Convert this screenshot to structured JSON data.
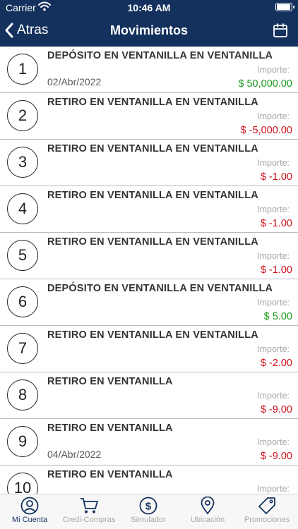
{
  "status": {
    "carrier": "Carrier",
    "time": "10:46 AM"
  },
  "nav": {
    "back_label": "Atras",
    "title": "Movimientos"
  },
  "movements": [
    {
      "index": "1",
      "description": "DEPÓSITO EN VENTANILLA EN VENTANILLA",
      "date": "02/Abr/2022",
      "amount_label": "Importe:",
      "amount": "$ 50,000.00",
      "sign": "pos"
    },
    {
      "index": "2",
      "description": "RETIRO EN VENTANILLA EN VENTANILLA",
      "date": "",
      "amount_label": "Importe:",
      "amount": "$ -5,000.00",
      "sign": "neg"
    },
    {
      "index": "3",
      "description": "RETIRO EN VENTANILLA EN VENTANILLA",
      "date": "",
      "amount_label": "Importe:",
      "amount": "$ -1.00",
      "sign": "neg"
    },
    {
      "index": "4",
      "description": "RETIRO EN VENTANILLA EN VENTANILLA",
      "date": "",
      "amount_label": "Importe:",
      "amount": "$ -1.00",
      "sign": "neg"
    },
    {
      "index": "5",
      "description": "RETIRO EN VENTANILLA EN VENTANILLA",
      "date": "",
      "amount_label": "Importe:",
      "amount": "$ -1.00",
      "sign": "neg"
    },
    {
      "index": "6",
      "description": "DEPÓSITO EN VENTANILLA EN VENTANILLA",
      "date": "",
      "amount_label": "Importe:",
      "amount": "$ 5.00",
      "sign": "pos"
    },
    {
      "index": "7",
      "description": "RETIRO EN VENTANILLA EN VENTANILLA",
      "date": "",
      "amount_label": "Importe:",
      "amount": "$ -2.00",
      "sign": "neg"
    },
    {
      "index": "8",
      "description": "RETIRO EN VENTANILLA",
      "date": "",
      "amount_label": "Importe:",
      "amount": "$ -9.00",
      "sign": "neg"
    },
    {
      "index": "9",
      "description": "RETIRO EN VENTANILLA",
      "date": "04/Abr/2022",
      "amount_label": "Importe:",
      "amount": "$ -9.00",
      "sign": "neg"
    },
    {
      "index": "10",
      "description": "RETIRO EN VENTANILLA",
      "date": "",
      "amount_label": "Importe:",
      "amount": "",
      "sign": "neg"
    }
  ],
  "tabs": [
    {
      "label": "Mi Cuenta",
      "icon": "user-icon",
      "active": true
    },
    {
      "label": "Credi-Compras",
      "icon": "cart-icon",
      "active": false
    },
    {
      "label": "Simulador",
      "icon": "dollar-icon",
      "active": false
    },
    {
      "label": "Ubicación",
      "icon": "location-pin-icon",
      "active": false
    },
    {
      "label": "Promociones",
      "icon": "tag-icon",
      "active": false
    }
  ],
  "colors": {
    "navbar": "#14315e",
    "positive": "#1b9a1b",
    "negative": "#d0101a",
    "tab_active": "#14315e",
    "tab_inactive": "#a8a8a8"
  }
}
